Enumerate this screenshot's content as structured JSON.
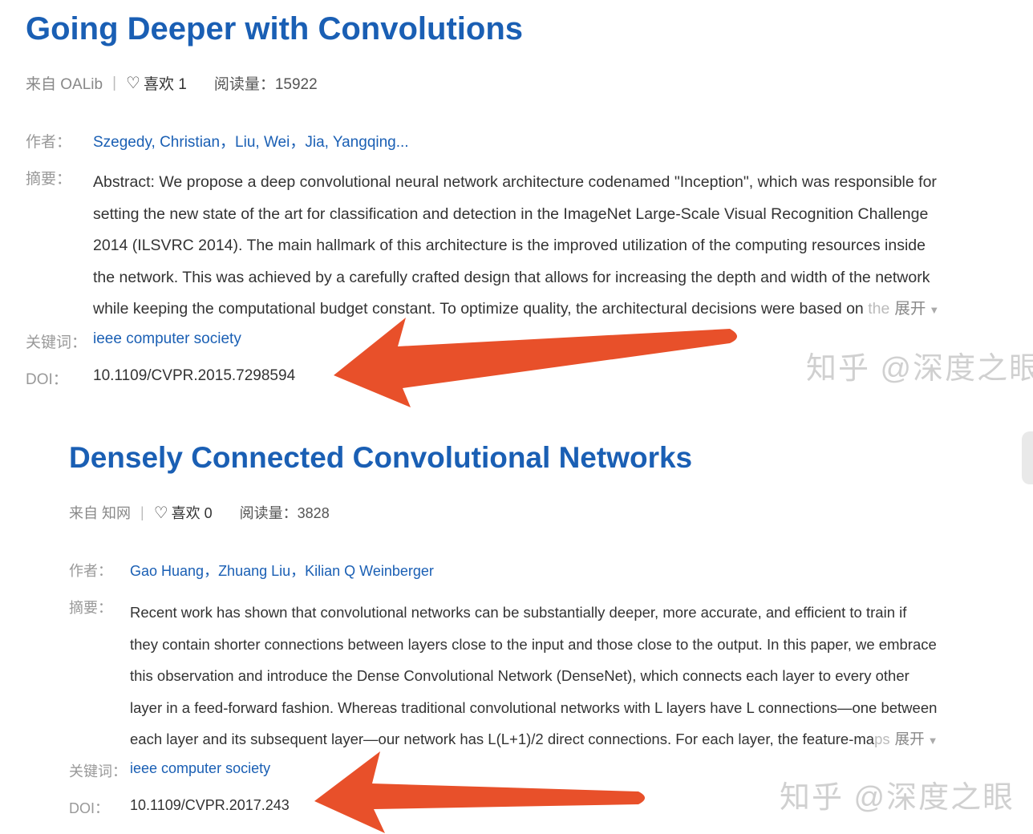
{
  "papers": [
    {
      "title": "Going Deeper with Convolutions",
      "source": "来自 OALib",
      "separator": "|",
      "likes": "喜欢 1",
      "reads": "阅读量：15922",
      "authors_label": "作者：",
      "authors": "Szegedy, Christian，Liu, Wei，Jia, Yangqing...",
      "abstract_label": "摘要：",
      "abstract_lines": [
        "Abstract: We propose a deep convolutional neural network architecture codenamed \"Inception\", which was responsible for",
        "setting the new state of the art for classification and detection in the ImageNet Large-Scale Visual Recognition Challenge",
        "2014 (ILSVRC 2014). The main hallmark of this architecture is the improved utilization of the computing resources inside",
        "the network. This was achieved by a carefully crafted design that allows for increasing the depth and width of the network",
        "while keeping the computational budget constant. To optimize quality, the architectural decisions were based on"
      ],
      "abstract_fade": "the",
      "expand_label": "展开",
      "keywords_label": "关键词：",
      "keywords": "ieee computer society",
      "doi_label": "DOI：",
      "doi": "10.1109/CVPR.2015.7298594",
      "watermark": "知乎 @深度之眼"
    },
    {
      "title": "Densely Connected Convolutional Networks",
      "source": "来自 知网",
      "separator": "|",
      "likes": "喜欢 0",
      "reads": "阅读量：3828",
      "authors_label": "作者：",
      "authors": "Gao Huang，Zhuang Liu，Kilian Q Weinberger",
      "abstract_label": "摘要：",
      "abstract_lines": [
        "Recent work has shown that convolutional networks can be substantially deeper, more accurate, and efficient to train if",
        "they contain shorter connections between layers close to the input and those close to the output. In this paper, we embrace",
        "this observation and introduce the Dense Convolutional Network (DenseNet), which connects each layer to every other",
        "layer in a feed-forward fashion. Whereas traditional convolutional networks with L layers have L connections—one between",
        "each layer and its subsequent layer—our network has L(L+1)/2 direct connections. For each layer, the feature-ma"
      ],
      "abstract_fade": "ps",
      "expand_label": "展开",
      "keywords_label": "关键词：",
      "keywords": "ieee computer society",
      "doi_label": "DOI：",
      "doi": "10.1109/CVPR.2017.243",
      "watermark": "知乎 @深度之眼"
    }
  ],
  "colors": {
    "title": "#1a5fb4",
    "link": "#1a5fb4",
    "arrow": "#e8502a",
    "watermark": "#d0d0d0"
  },
  "icons": {
    "heart": "heart-icon",
    "expand": "triangle-down-icon",
    "arrow": "red-arrow-annotation"
  }
}
